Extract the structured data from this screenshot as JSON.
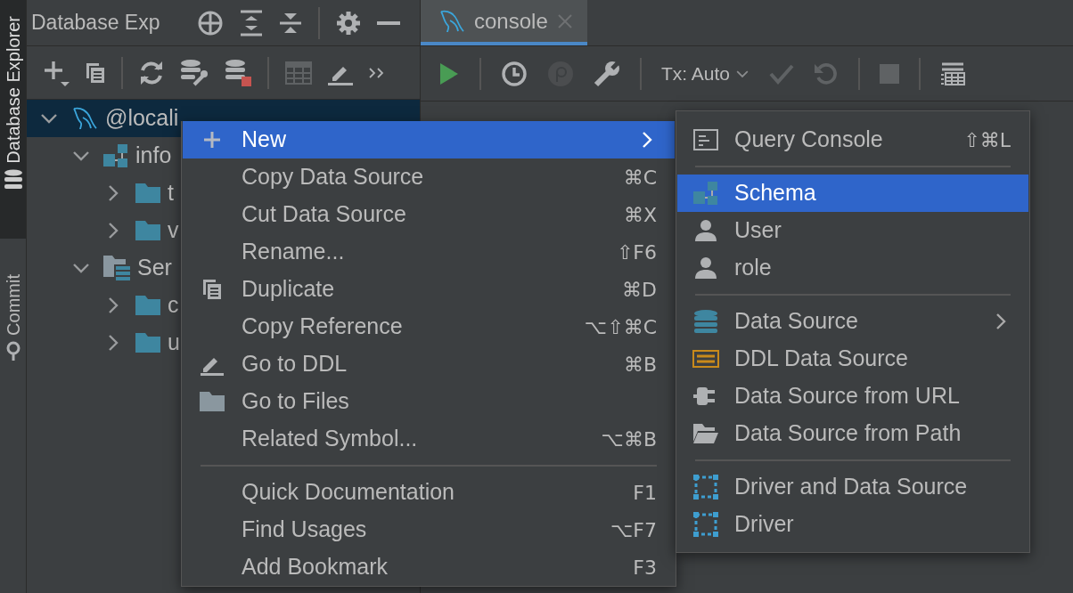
{
  "side_stripe": [
    {
      "label": "Database Explorer",
      "selected": true
    },
    {
      "label": "Commit",
      "selected": false
    }
  ],
  "explorer": {
    "title": "Database Exp",
    "toolbar": [
      {
        "disabled": false
      },
      {
        "disabled": false
      },
      {
        "kind": "separator"
      },
      {
        "disabled": false
      },
      {
        "disabled": false
      },
      {
        "disabled": false
      },
      {
        "kind": "separator"
      },
      {
        "disabled": true
      },
      {
        "disabled": false
      },
      {
        "disabled": false
      }
    ],
    "tree": [
      {
        "label": "@locali",
        "kind": "datasource",
        "expanded": true,
        "selected": true,
        "children": [
          {
            "label": "info",
            "kind": "schema",
            "expanded": true,
            "selected": false,
            "children": [
              {
                "label": "t",
                "kind": "folder",
                "expanded": false,
                "selected": false
              },
              {
                "label": "v",
                "kind": "folder",
                "expanded": false,
                "selected": false
              }
            ]
          },
          {
            "label": "Ser",
            "kind": "server-objects",
            "expanded": true,
            "selected": false,
            "children": [
              {
                "label": "c",
                "kind": "folder",
                "expanded": false,
                "selected": false
              },
              {
                "label": "u",
                "kind": "folder",
                "expanded": false,
                "selected": false
              }
            ]
          }
        ]
      }
    ]
  },
  "editor": {
    "tabs": [
      {
        "label": "console",
        "selected": true
      }
    ],
    "toolbar": [
      {
        "kind": "run",
        "disabled": false
      },
      {
        "kind": "separator"
      },
      {
        "kind": "history",
        "disabled": false
      },
      {
        "kind": "profile",
        "disabled": true
      },
      {
        "kind": "settings",
        "disabled": false
      },
      {
        "kind": "separator"
      },
      {
        "kind": "dropdown",
        "label": "Tx: Auto"
      },
      {
        "kind": "commit",
        "disabled": true
      },
      {
        "kind": "rollback",
        "disabled": true
      },
      {
        "kind": "separator"
      },
      {
        "kind": "stop",
        "disabled": true
      },
      {
        "kind": "separator"
      },
      {
        "kind": "layout",
        "disabled": false
      }
    ]
  },
  "context_menu": {
    "items": [
      {
        "kind": "item",
        "label": "New",
        "selected": true,
        "submenu": true
      },
      {
        "kind": "item",
        "label": "Copy Data Source",
        "shortcut": "⌘C",
        "selected": false
      },
      {
        "kind": "item",
        "label": "Cut Data Source",
        "shortcut": "⌘X",
        "selected": false
      },
      {
        "kind": "item",
        "label": "Rename...",
        "shortcut": "⇧F6",
        "selected": false
      },
      {
        "kind": "item",
        "label": "Duplicate",
        "shortcut": "⌘D",
        "selected": false
      },
      {
        "kind": "item",
        "label": "Copy Reference",
        "shortcut": "⌥⇧⌘C",
        "selected": false
      },
      {
        "kind": "item",
        "label": "Go to DDL",
        "shortcut": "⌘B",
        "selected": false
      },
      {
        "kind": "item",
        "label": "Go to Files",
        "selected": false
      },
      {
        "kind": "item",
        "label": "Related Symbol...",
        "shortcut": "⌥⌘B",
        "selected": false
      },
      {
        "kind": "separator"
      },
      {
        "kind": "item",
        "label": "Quick Documentation",
        "shortcut": "F1",
        "selected": false
      },
      {
        "kind": "item",
        "label": "Find Usages",
        "shortcut": "⌥F7",
        "selected": false
      },
      {
        "kind": "item",
        "label": "Add Bookmark",
        "shortcut": "F3",
        "selected": false
      }
    ]
  },
  "submenu": {
    "items": [
      {
        "kind": "item",
        "label": "Query Console",
        "shortcut": "⇧⌘L",
        "selected": false
      },
      {
        "kind": "separator"
      },
      {
        "kind": "item",
        "label": "Schema",
        "selected": true
      },
      {
        "kind": "item",
        "label": "User",
        "selected": false
      },
      {
        "kind": "item",
        "label": "role",
        "selected": false
      },
      {
        "kind": "separator"
      },
      {
        "kind": "item",
        "label": "Data Source",
        "selected": false,
        "submenu": true
      },
      {
        "kind": "item",
        "label": "DDL Data Source",
        "selected": false
      },
      {
        "kind": "item",
        "label": "Data Source from URL",
        "selected": false
      },
      {
        "kind": "item",
        "label": "Data Source from Path",
        "selected": false
      },
      {
        "kind": "separator"
      },
      {
        "kind": "item",
        "label": "Driver and Data Source",
        "selected": false
      },
      {
        "kind": "item",
        "label": "Driver",
        "selected": false
      }
    ]
  }
}
